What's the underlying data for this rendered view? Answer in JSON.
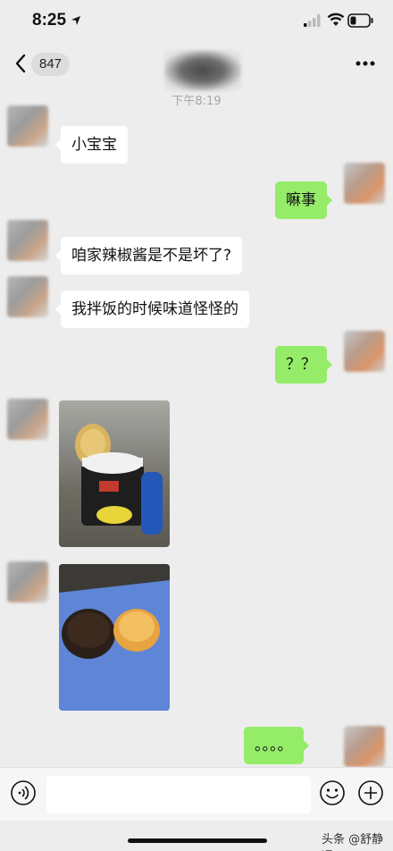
{
  "status": {
    "time": "8:25"
  },
  "nav": {
    "unread_count": "847"
  },
  "chat": {
    "timestamp": "下午8:19",
    "messages": [
      {
        "side": "in",
        "text": "小宝宝"
      },
      {
        "side": "out",
        "text": "嘛事"
      },
      {
        "side": "in",
        "text": "咱家辣椒酱是不是坏了?"
      },
      {
        "side": "in",
        "text": "我拌饭的时候味道怪怪的"
      },
      {
        "side": "out",
        "text": "？？"
      },
      {
        "side": "out",
        "text": "。。。。"
      }
    ]
  },
  "input": {
    "placeholder": ""
  },
  "watermark": "头条 @舒静通",
  "colors": {
    "outgoing_bubble": "#95ec69",
    "incoming_bubble": "#ffffff",
    "background": "#ededed"
  }
}
